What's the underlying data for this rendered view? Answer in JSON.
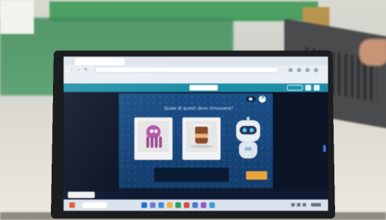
{
  "browser": {
    "tab_label": "",
    "url": ""
  },
  "app_header": {
    "title": ""
  },
  "modal": {
    "question": "Quale di questi devo rimuovere?",
    "dialog": "",
    "next_label": ""
  },
  "taskbar": {
    "notification": ""
  },
  "colors": {
    "header": "#1f8fa8",
    "modal": "#1b4f86",
    "next_button": "#e7a53a",
    "octopus": "#b45aa8",
    "robot_eye": "#56c8ff"
  },
  "icons": [
    "speaker-icon",
    "close-icon",
    "octopus-card",
    "coffee-card",
    "robot-mascot"
  ]
}
